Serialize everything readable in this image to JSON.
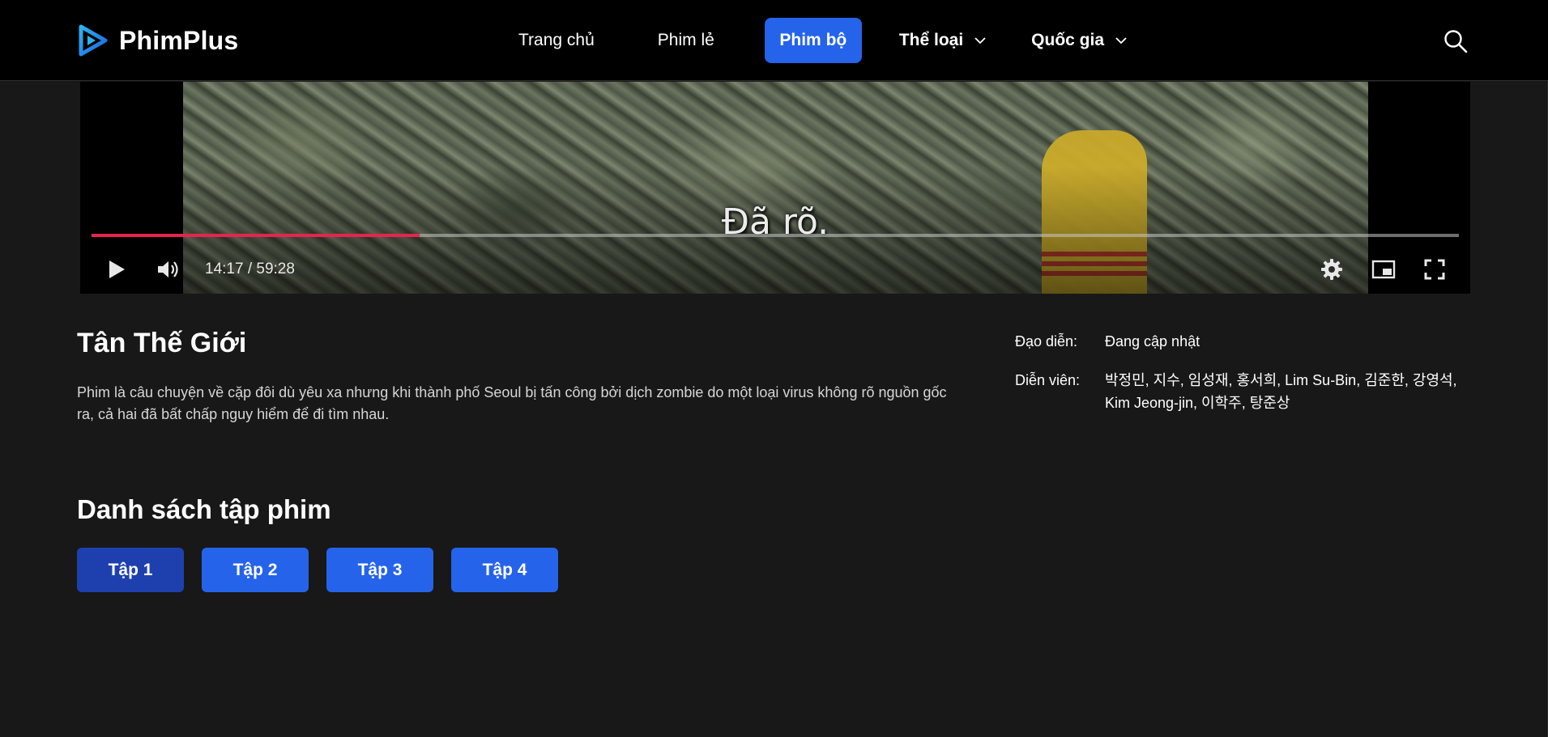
{
  "header": {
    "logo_text": "PhimPlus",
    "brand_color": "#2563eb",
    "nav": [
      {
        "label": "Trang chủ"
      },
      {
        "label": "Phim lẻ"
      },
      {
        "label": "Phim bộ",
        "active": true
      },
      {
        "label": "Thể loại",
        "dropdown": true
      },
      {
        "label": "Quốc gia",
        "dropdown": true
      }
    ],
    "search_icon": "search-icon"
  },
  "player": {
    "subtitle": "Đã rõ.",
    "time_display": "14:17 / 59:28",
    "progress_fraction": 0.24,
    "progress_color": "#e8244d",
    "icons": [
      "play-icon",
      "volume-icon",
      "settings-icon",
      "miniplayer-icon",
      "fullscreen-icon"
    ]
  },
  "movie": {
    "title": "Tân Thế Giới",
    "description": "Phim là câu chuyện về cặp đôi dù yêu xa nhưng khi thành phố Seoul bị tấn công bởi dịch zombie do một loại virus không rõ nguồn gốc ra, cả hai đã bất chấp nguy hiểm để đi tìm nhau.",
    "director_label": "Đạo diễn:",
    "director_value": "Đang cập nhật",
    "cast_label": "Diễn viên:",
    "cast_value": "박정민, 지수, 임성재, 홍서희, Lim Su-Bin, 김준한, 강영석, Kim Jeong-jin, 이학주, 탕준상"
  },
  "episodes": {
    "heading": "Danh sách tập phim",
    "items": [
      {
        "label": "Tập 1",
        "active": true
      },
      {
        "label": "Tập 2"
      },
      {
        "label": "Tập 3"
      },
      {
        "label": "Tập 4"
      }
    ],
    "active_color": "#1e40af"
  }
}
